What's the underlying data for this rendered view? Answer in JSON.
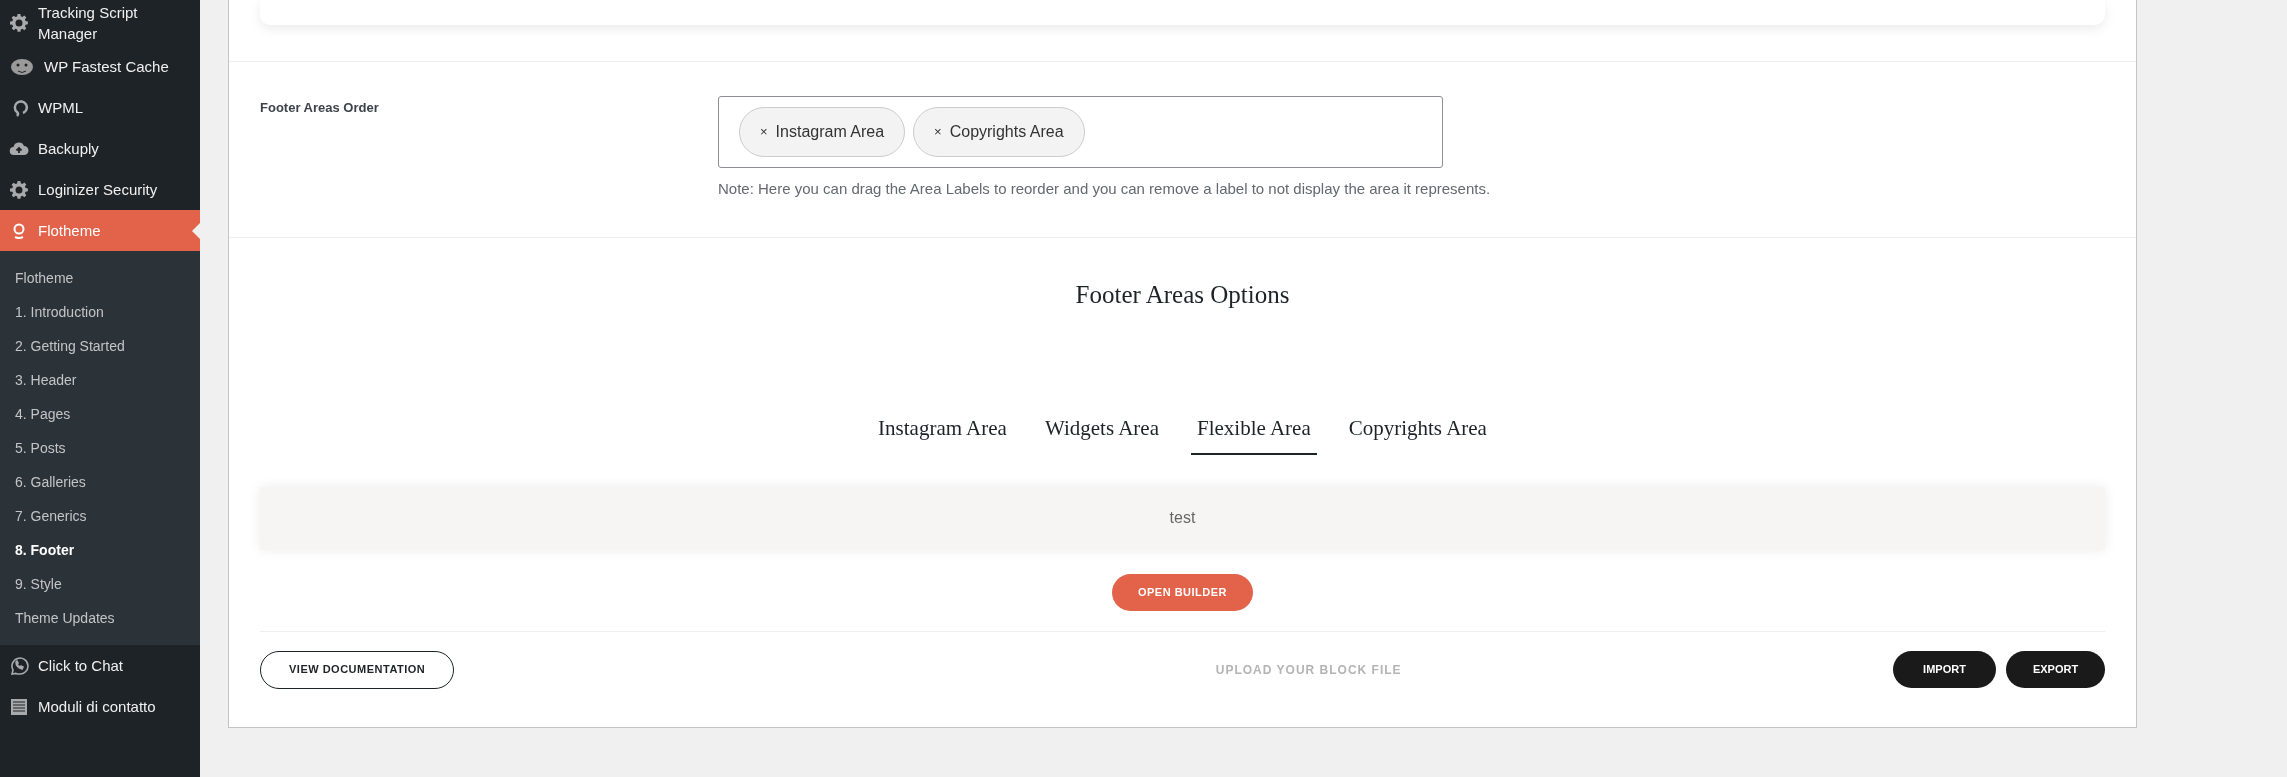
{
  "sidebar": {
    "items": [
      {
        "label": "Tracking Script Manager",
        "selected": false
      },
      {
        "label": "WP Fastest Cache",
        "selected": false
      },
      {
        "label": "WPML",
        "selected": false
      },
      {
        "label": "Backuply",
        "selected": false
      },
      {
        "label": "Loginizer Security",
        "selected": false
      },
      {
        "label": "Flotheme",
        "selected": true,
        "children": [
          {
            "label": "Flotheme",
            "selected": false
          },
          {
            "label": "1. Introduction",
            "selected": false
          },
          {
            "label": "2. Getting Started",
            "selected": false
          },
          {
            "label": "3. Header",
            "selected": false
          },
          {
            "label": "4. Pages",
            "selected": false
          },
          {
            "label": "5. Posts",
            "selected": false
          },
          {
            "label": "6. Galleries",
            "selected": false
          },
          {
            "label": "7. Generics",
            "selected": false
          },
          {
            "label": "8. Footer",
            "selected": true
          },
          {
            "label": "9. Style",
            "selected": false
          },
          {
            "label": "Theme Updates",
            "selected": false
          }
        ]
      },
      {
        "label": "Click to Chat",
        "selected": false
      },
      {
        "label": "Moduli di contatto",
        "selected": false
      }
    ]
  },
  "footer_areas_order": {
    "label": "Footer Areas Order",
    "tags": [
      "Instagram Area",
      "Copyrights Area"
    ],
    "remove_symbol": "×",
    "note": "Note: Here you can drag the Area Labels to reorder and you can remove a label to not display the area it represents."
  },
  "footer_areas_options": {
    "title": "Footer Areas Options",
    "tabs": [
      {
        "label": "Instagram Area",
        "selected": false
      },
      {
        "label": "Widgets Area",
        "selected": false
      },
      {
        "label": "Flexible Area",
        "selected": true
      },
      {
        "label": "Copyrights Area",
        "selected": false
      }
    ],
    "block_name": "test",
    "open_builder": "OPEN BUILDER"
  },
  "actions": {
    "documentation": "VIEW DOCUMENTATION",
    "upload": "UPLOAD YOUR BLOCK FILE",
    "import": "IMPORT",
    "export": "EXPORT"
  }
}
